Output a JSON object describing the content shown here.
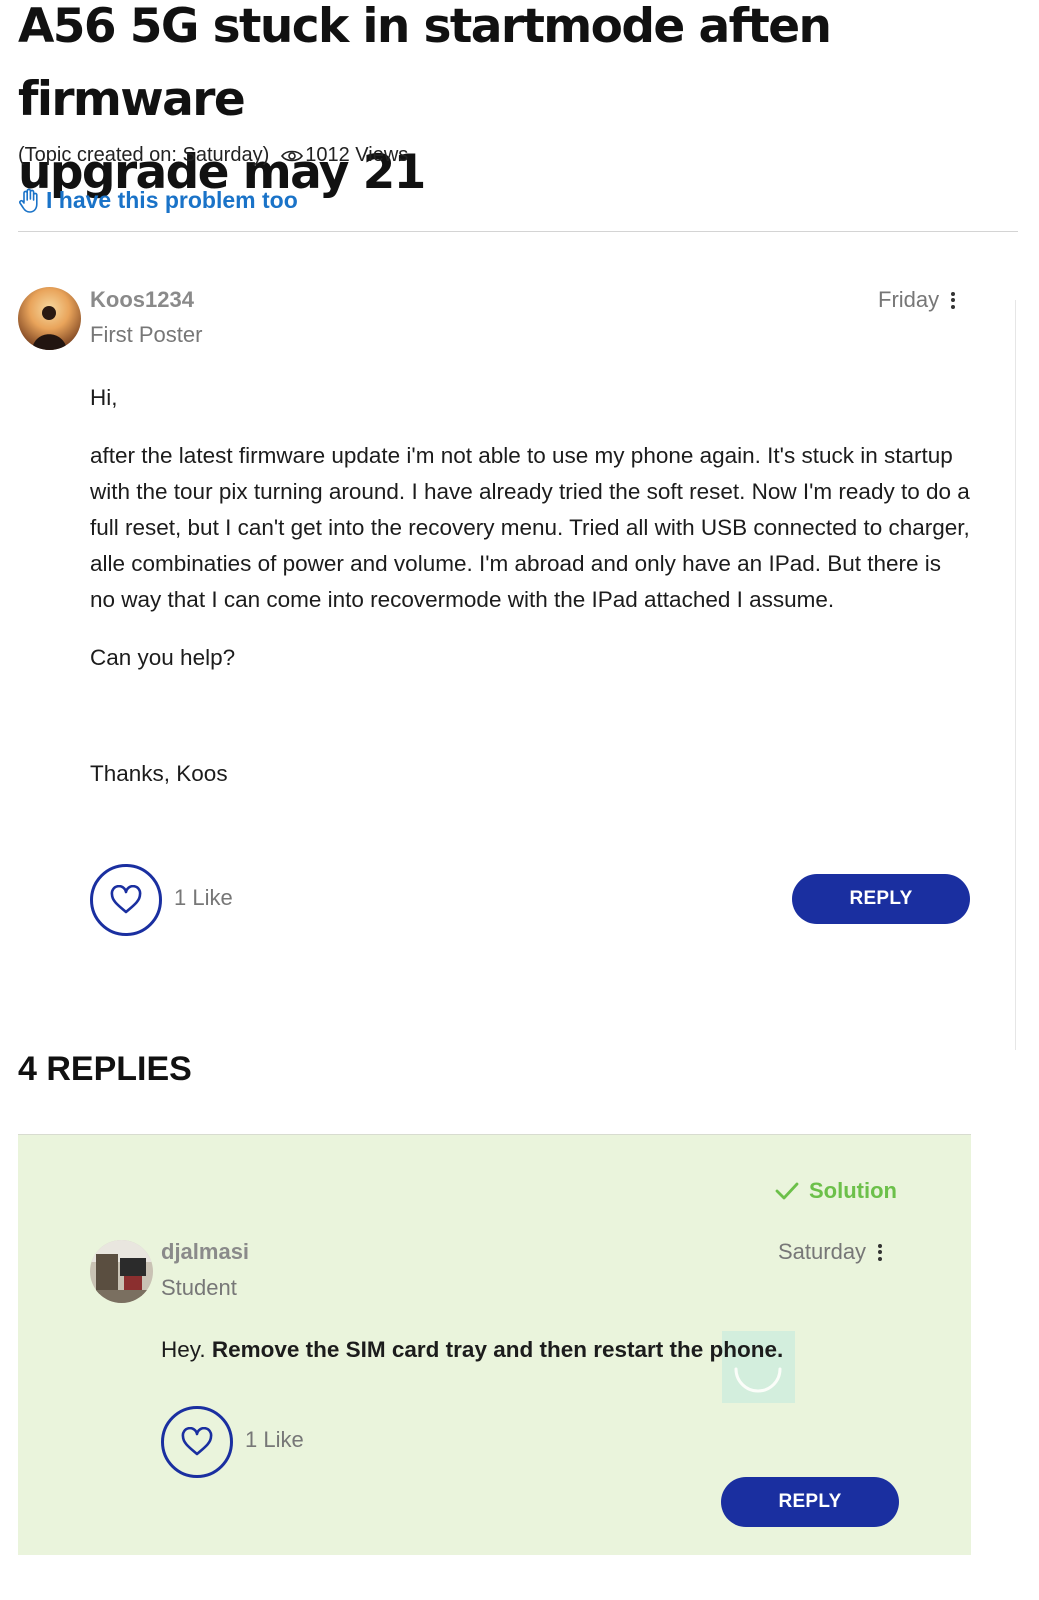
{
  "topic": {
    "title_line1": "A56 5G stuck in startmode aften firmware",
    "title_line2": "upgrade may 21",
    "created": "(Topic created on: Saturday)",
    "views": "1012 Views",
    "problem_label": "I have this problem too"
  },
  "post": {
    "author": "Koos1234",
    "rank": "First Poster",
    "date": "Friday",
    "paragraphs": [
      "Hi,",
      "after the latest firmware update i'm not able to use my phone again. It's stuck in startup with the tour pix turning around. I have already tried the soft reset. Now I'm ready to do a full reset, but I can't get into the recovery menu. Tried all with USB connected to charger, alle combinaties of power and volume. I'm abroad and only have an IPad. But there is no way that I can come into recovermode with the IPad attached I assume.",
      "Can you help?",
      "Thanks, Koos"
    ],
    "likes": "1 Like",
    "reply_label": "REPLY"
  },
  "replies_heading": "4 REPLIES",
  "reply": {
    "solution_label": "Solution",
    "author": "djalmasi",
    "rank": "Student",
    "date": "Saturday",
    "text_plain": "Hey. ",
    "text_bold": "Remove the SIM card tray and then restart the phone.",
    "likes": "1 Like",
    "reply_label": "REPLY"
  },
  "colors": {
    "accent": "#1a2fa0",
    "link": "#1a73c8",
    "solution_green": "#6cc04a",
    "solution_bg": "#eaf4dc"
  }
}
